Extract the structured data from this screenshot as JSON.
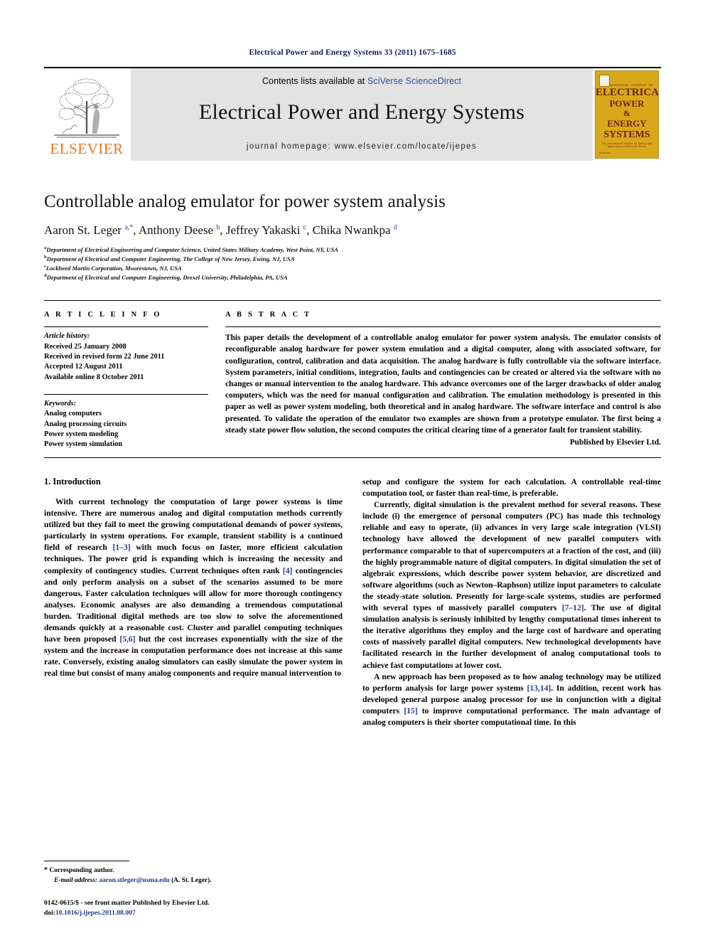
{
  "running_head": "Electrical Power and Energy Systems 33 (2011) 1675–1685",
  "masthead": {
    "publisher_name": "ELSEVIER",
    "contents_prefix": "Contents lists available at ",
    "contents_link": "SciVerse ScienceDirect",
    "journal_title": "Electrical Power and Energy Systems",
    "homepage": "journal homepage: www.elsevier.com/locate/ijepes",
    "cover": {
      "header": "INTERNATIONAL JOURNAL OF",
      "line1": "ELECTRICAL",
      "line2": "POWER",
      "line3": "&",
      "line4": "ENERGY",
      "line5": "SYSTEMS",
      "subtitle": "The International Journal for Theory and Application of Electrical Power",
      "footer": "ELSEVIER"
    }
  },
  "article": {
    "title": "Controllable analog emulator for power system analysis",
    "authors_html": "Aaron St. Leger <sup>a,*</sup>, Anthony Deese <sup>b</sup>, Jeffrey Yakaski <sup>c</sup>, Chika Nwankpa <sup>d</sup>",
    "affiliations": [
      {
        "mark": "a",
        "text": "Department of Electrical Engineering and Computer Science, United States Military Academy, West Point, NY, USA"
      },
      {
        "mark": "b",
        "text": "Department of Electrical and Computer Engineering, The College of New Jersey, Ewing, NJ, USA"
      },
      {
        "mark": "c",
        "text": "Lockheed Martin Corporation, Moorestown, NJ, USA"
      },
      {
        "mark": "d",
        "text": "Department of Electrical and Computer Engineering, Drexel University, Philadelphia, PA, USA"
      }
    ]
  },
  "article_info": {
    "heading": "A R T I C L E    I N F O",
    "history_label": "Article history:",
    "history": [
      "Received 25 January 2008",
      "Received in revised form 22 June 2011",
      "Accepted 12 August 2011",
      "Available online 8 October 2011"
    ],
    "keywords_label": "Keywords:",
    "keywords": [
      "Analog computers",
      "Analog processing circuits",
      "Power system modeling",
      "Power system simulation"
    ]
  },
  "abstract": {
    "heading": "A B S T R A C T",
    "text": "This paper details the development of a controllable analog emulator for power system analysis. The emulator consists of reconfigurable analog hardware for power system emulation and a digital computer, along with associated software, for configuration, control, calibration and data acquisition. The analog hardware is fully controllable via the software interface. System parameters, initial conditions, integration, faults and contingencies can be created or altered via the software with no changes or manual intervention to the analog hardware. This advance overcomes one of the larger drawbacks of older analog computers, which was the need for manual configuration and calibration. The emulation methodology is presented in this paper as well as power system modeling, both theoretical and in analog hardware. The software interface and control is also presented. To validate the operation of the emulator two examples are shown from a prototype emulator. The first being a steady state power flow solution, the second computes the critical clearing time of a generator fault for transient stability.",
    "published_by": "Published by Elsevier Ltd."
  },
  "body": {
    "section_heading": "1. Introduction",
    "left_col_html": "With current technology the computation of large power systems is time intensive. There are numerous analog and digital computation methods currently utilized but they fail to meet the growing computational demands of power systems, particularly in system operations. For example, transient stability is a continued field of research <span class=\"ref\">[1–3]</span> with much focus on faster, more efficient calculation techniques. The power grid is expanding which is increasing the necessity and complexity of contingency studies. Current techniques often rank <span class=\"ref\">[4]</span> contingencies and only perform analysis on a subset of the scenarios assumed to be more dangerous. Faster calculation techniques will allow for more thorough contingency analyses. Economic analyses are also demanding a tremendous computational burden. Traditional digital methods are too slow to solve the aforementioned demands quickly at a reasonable cost. Cluster and parallel computing techniques have been proposed <span class=\"ref\">[5,6]</span> but the cost increases exponentially with the size of the system and the increase in computation performance does not increase at this same rate. Conversely, existing analog simulators can easily simulate the power system in real time but consist of many analog components and require manual intervention to",
    "right_col_p1_html": "setup and configure the system for each calculation. A controllable real-time computation tool, or faster than real-time, is preferable.",
    "right_col_p2_html": "Currently, digital simulation is the prevalent method for several reasons. These include (i) the emergence of personal computers (PC) has made this technology reliable and easy to operate, (ii) advances in very large scale integration (VLSI) technology have allowed the development of new parallel computers with performance comparable to that of supercomputers at a fraction of the cost, and (iii) the highly programmable nature of digital computers. In digital simulation the set of algebraic expressions, which describe power system behavior, are discretized and software algorithms (such as Newton–Raphson) utilize input parameters to calculate the steady-state solution. Presently for large-scale systems, studies are performed with several types of massively parallel computers <span class=\"ref\">[7–12]</span>. The use of digital simulation analysis is seriously inhibited by lengthy computational times inherent to the iterative algorithms they employ and the large cost of hardware and operating costs of massively parallel digital computers. New technological developments have facilitated research in the further development of analog computational tools to achieve fast computations at lower cost.",
    "right_col_p3_html": "A new approach has been proposed as to how analog technology may be utilized to perform analysis for large power systems <span class=\"ref\">[13,14]</span>. In addition, recent work has developed general purpose analog processor for use in conjunction with a digital computers <span class=\"ref\">[15]</span> to improve computational performance. The main advantage of analog computers is their shorter computational time. In this"
  },
  "footnotes": {
    "corresponding_author": "Corresponding author.",
    "email_label": "E-mail address:",
    "email": "aaron.stleger@usma.edu",
    "email_owner": "(A. St. Leger).",
    "issn_line": "0142-0615/$ - see front matter Published by Elsevier Ltd.",
    "doi_label": "doi:",
    "doi": "10.1016/j.ijepes.2011.08.007"
  },
  "colors": {
    "link": "#1d3c91",
    "running_head": "#141c5a",
    "elsevier_orange": "#E87722",
    "banner_grey": "#e3e3e3",
    "cover_gold": "#d8a81b"
  }
}
